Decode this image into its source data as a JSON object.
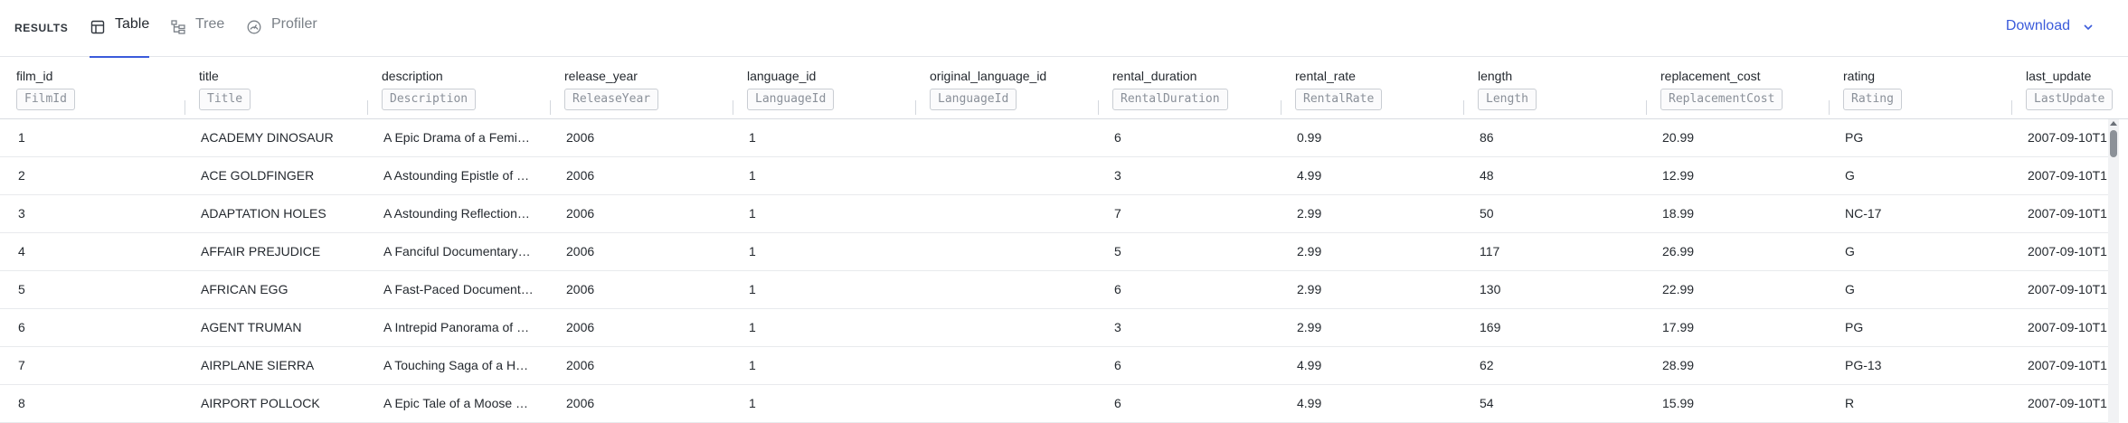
{
  "header": {
    "results_label": "RESULTS",
    "tabs": [
      {
        "label": "Table",
        "icon": "table-icon",
        "active": true
      },
      {
        "label": "Tree",
        "icon": "tree-icon",
        "active": false
      },
      {
        "label": "Profiler",
        "icon": "profiler-icon",
        "active": false
      }
    ],
    "download_label": "Download"
  },
  "table": {
    "columns": [
      {
        "name": "film_id",
        "filter_placeholder": "FilmId"
      },
      {
        "name": "title",
        "filter_placeholder": "Title"
      },
      {
        "name": "description",
        "filter_placeholder": "Description"
      },
      {
        "name": "release_year",
        "filter_placeholder": "ReleaseYear"
      },
      {
        "name": "language_id",
        "filter_placeholder": "LanguageId"
      },
      {
        "name": "original_language_id",
        "filter_placeholder": "LanguageId"
      },
      {
        "name": "rental_duration",
        "filter_placeholder": "RentalDuration"
      },
      {
        "name": "rental_rate",
        "filter_placeholder": "RentalRate"
      },
      {
        "name": "length",
        "filter_placeholder": "Length"
      },
      {
        "name": "replacement_cost",
        "filter_placeholder": "ReplacementCost"
      },
      {
        "name": "rating",
        "filter_placeholder": "Rating"
      },
      {
        "name": "last_update",
        "filter_placeholder": "LastUpdate"
      }
    ],
    "rows": [
      [
        "1",
        "ACADEMY DINOSAUR",
        "A Epic Drama of a Femi…",
        "2006",
        "1",
        "",
        "6",
        "0.99",
        "86",
        "20.99",
        "PG",
        "2007-09-10T1"
      ],
      [
        "2",
        "ACE GOLDFINGER",
        "A Astounding Epistle of …",
        "2006",
        "1",
        "",
        "3",
        "4.99",
        "48",
        "12.99",
        "G",
        "2007-09-10T1"
      ],
      [
        "3",
        "ADAPTATION HOLES",
        "A Astounding Reflection…",
        "2006",
        "1",
        "",
        "7",
        "2.99",
        "50",
        "18.99",
        "NC-17",
        "2007-09-10T1"
      ],
      [
        "4",
        "AFFAIR PREJUDICE",
        "A Fanciful Documentary …",
        "2006",
        "1",
        "",
        "5",
        "2.99",
        "117",
        "26.99",
        "G",
        "2007-09-10T1"
      ],
      [
        "5",
        "AFRICAN EGG",
        "A Fast-Paced Document…",
        "2006",
        "1",
        "",
        "6",
        "2.99",
        "130",
        "22.99",
        "G",
        "2007-09-10T1"
      ],
      [
        "6",
        "AGENT TRUMAN",
        "A Intrepid Panorama of …",
        "2006",
        "1",
        "",
        "3",
        "2.99",
        "169",
        "17.99",
        "PG",
        "2007-09-10T1"
      ],
      [
        "7",
        "AIRPLANE SIERRA",
        "A Touching Saga of a H…",
        "2006",
        "1",
        "",
        "6",
        "4.99",
        "62",
        "28.99",
        "PG-13",
        "2007-09-10T1"
      ],
      [
        "8",
        "AIRPORT POLLOCK",
        "A Epic Tale of a Moose …",
        "2006",
        "1",
        "",
        "6",
        "4.99",
        "54",
        "15.99",
        "R",
        "2007-09-10T1"
      ]
    ]
  },
  "colors": {
    "accent": "#3b5bdb",
    "border": "#e3e6ea",
    "text": "#24292f",
    "muted": "#7a8087"
  }
}
